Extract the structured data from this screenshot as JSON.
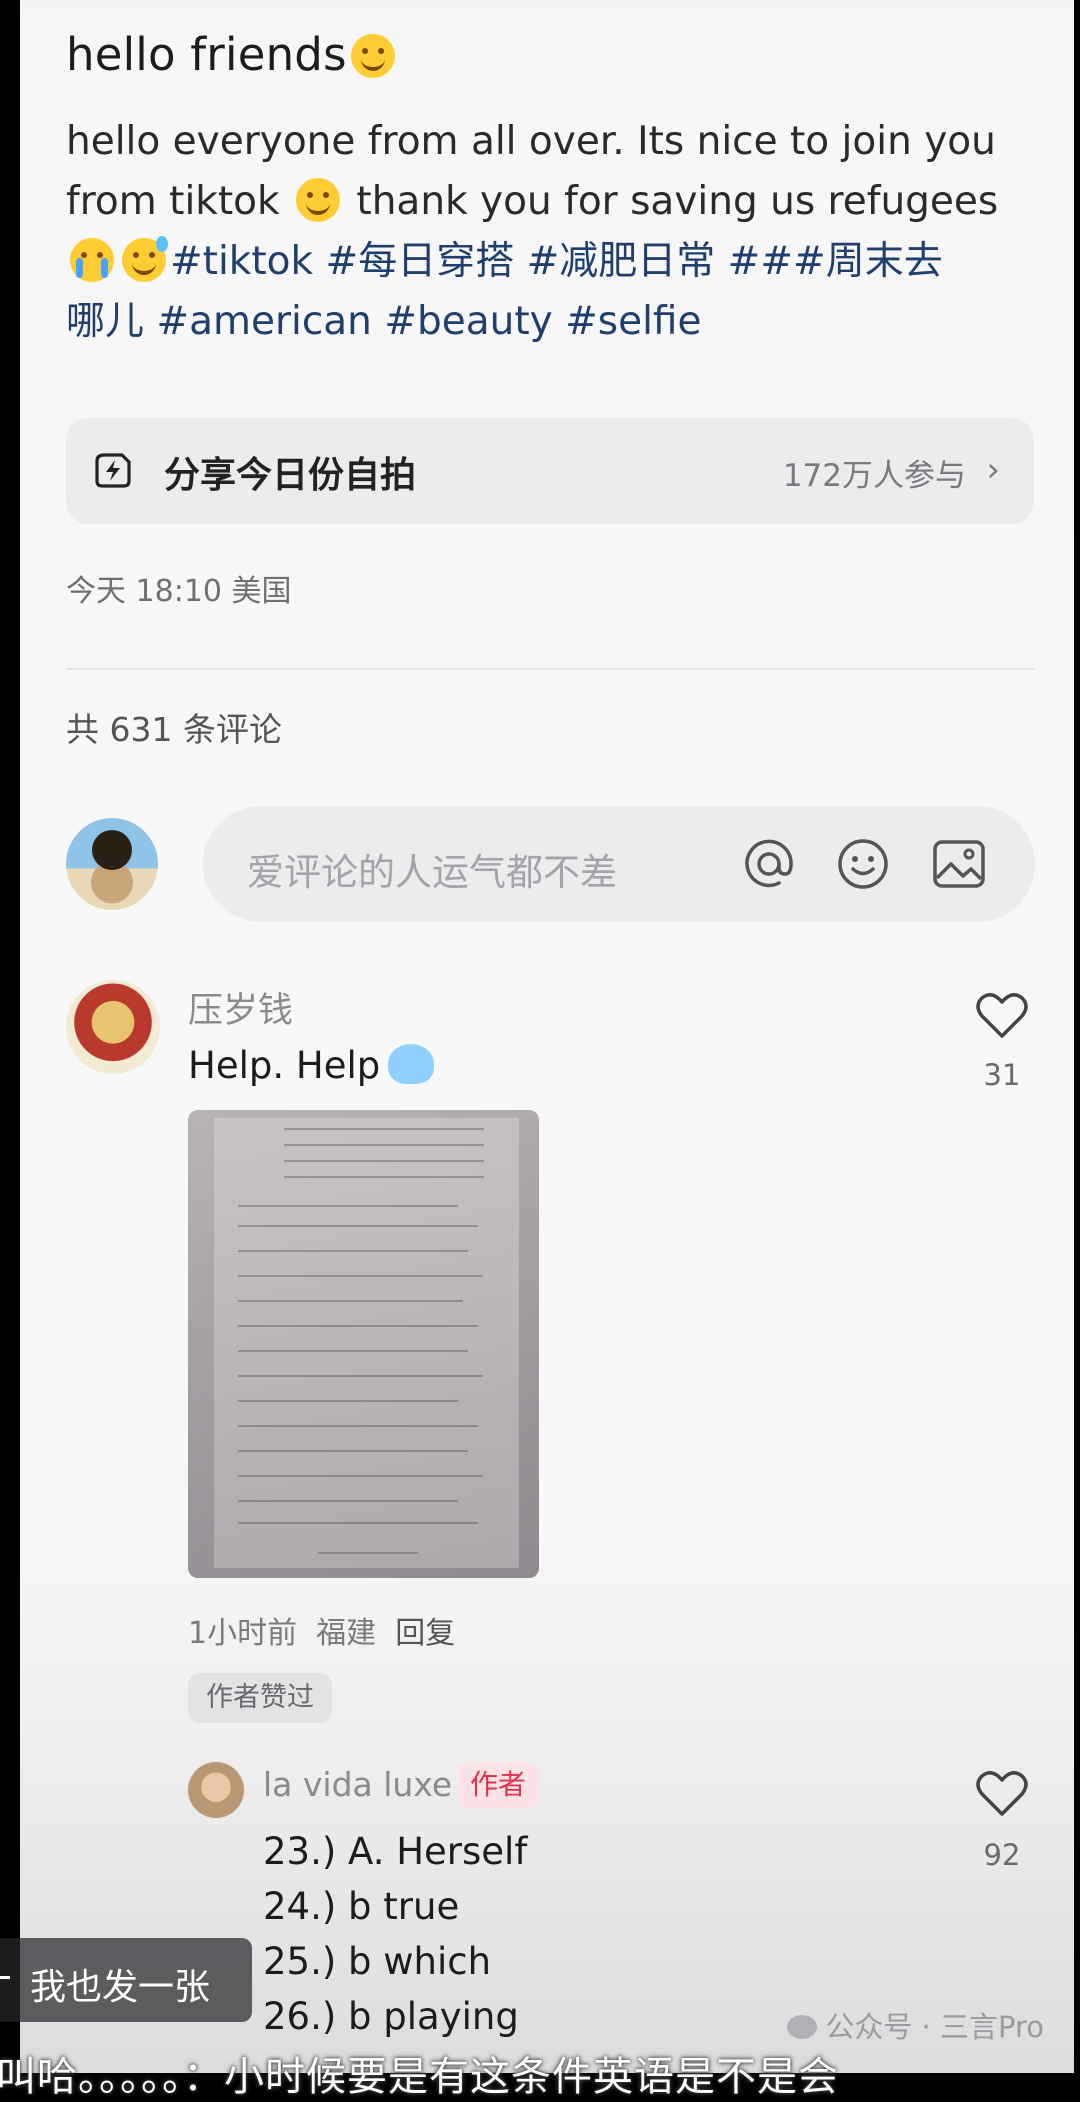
{
  "post": {
    "title": "hello friends",
    "desc_line1": "hello everyone from all over. Its nice to join you",
    "desc_line2_a": "from tiktok",
    "desc_line2_b": "thank you for saving us refugees",
    "tags_line3": "#tiktok #每日穿搭 #减肥日常 ###周末去",
    "tags_line4": "哪儿 #american  #beauty #selfie",
    "emoji_icons": [
      "smile-emoji",
      "cry-emoji",
      "sweat-smile-emoji"
    ]
  },
  "challenge": {
    "name": "分享今日份自拍",
    "count": "172万人参与",
    "icon": "lightning-icon",
    "chevron": "chevron-right-icon"
  },
  "meta": {
    "time_location": "今天 18:10 美国"
  },
  "comments_header": {
    "total": "共 631 条评论"
  },
  "comment_input": {
    "placeholder": "爱评论的人运气都不差",
    "icons": [
      "at-icon",
      "emoji-icon",
      "image-icon"
    ]
  },
  "comments": [
    {
      "author": "压岁钱",
      "text": "Help. Help",
      "likes": "31",
      "time": "1小时前",
      "location": "福建",
      "reply_label": "回复",
      "badge": "作者赞过"
    }
  ],
  "reply": {
    "author": "la vida luxe",
    "author_tag": "作者",
    "likes": "92",
    "lines": [
      "23.) A. Herself",
      "24.) b true",
      "25.) b which",
      "26.) b playing"
    ]
  },
  "overlay": {
    "floating_button": "我也发一张",
    "watermark": "公众号 · 三言Pro",
    "subtitle": "叫哈。。。。。：小时候要是有这条件英语是不是会"
  },
  "colors": {
    "accent_tag": "#1f3f6f",
    "author_tag_red": "#e0314f",
    "background": "#f7f7f8"
  }
}
